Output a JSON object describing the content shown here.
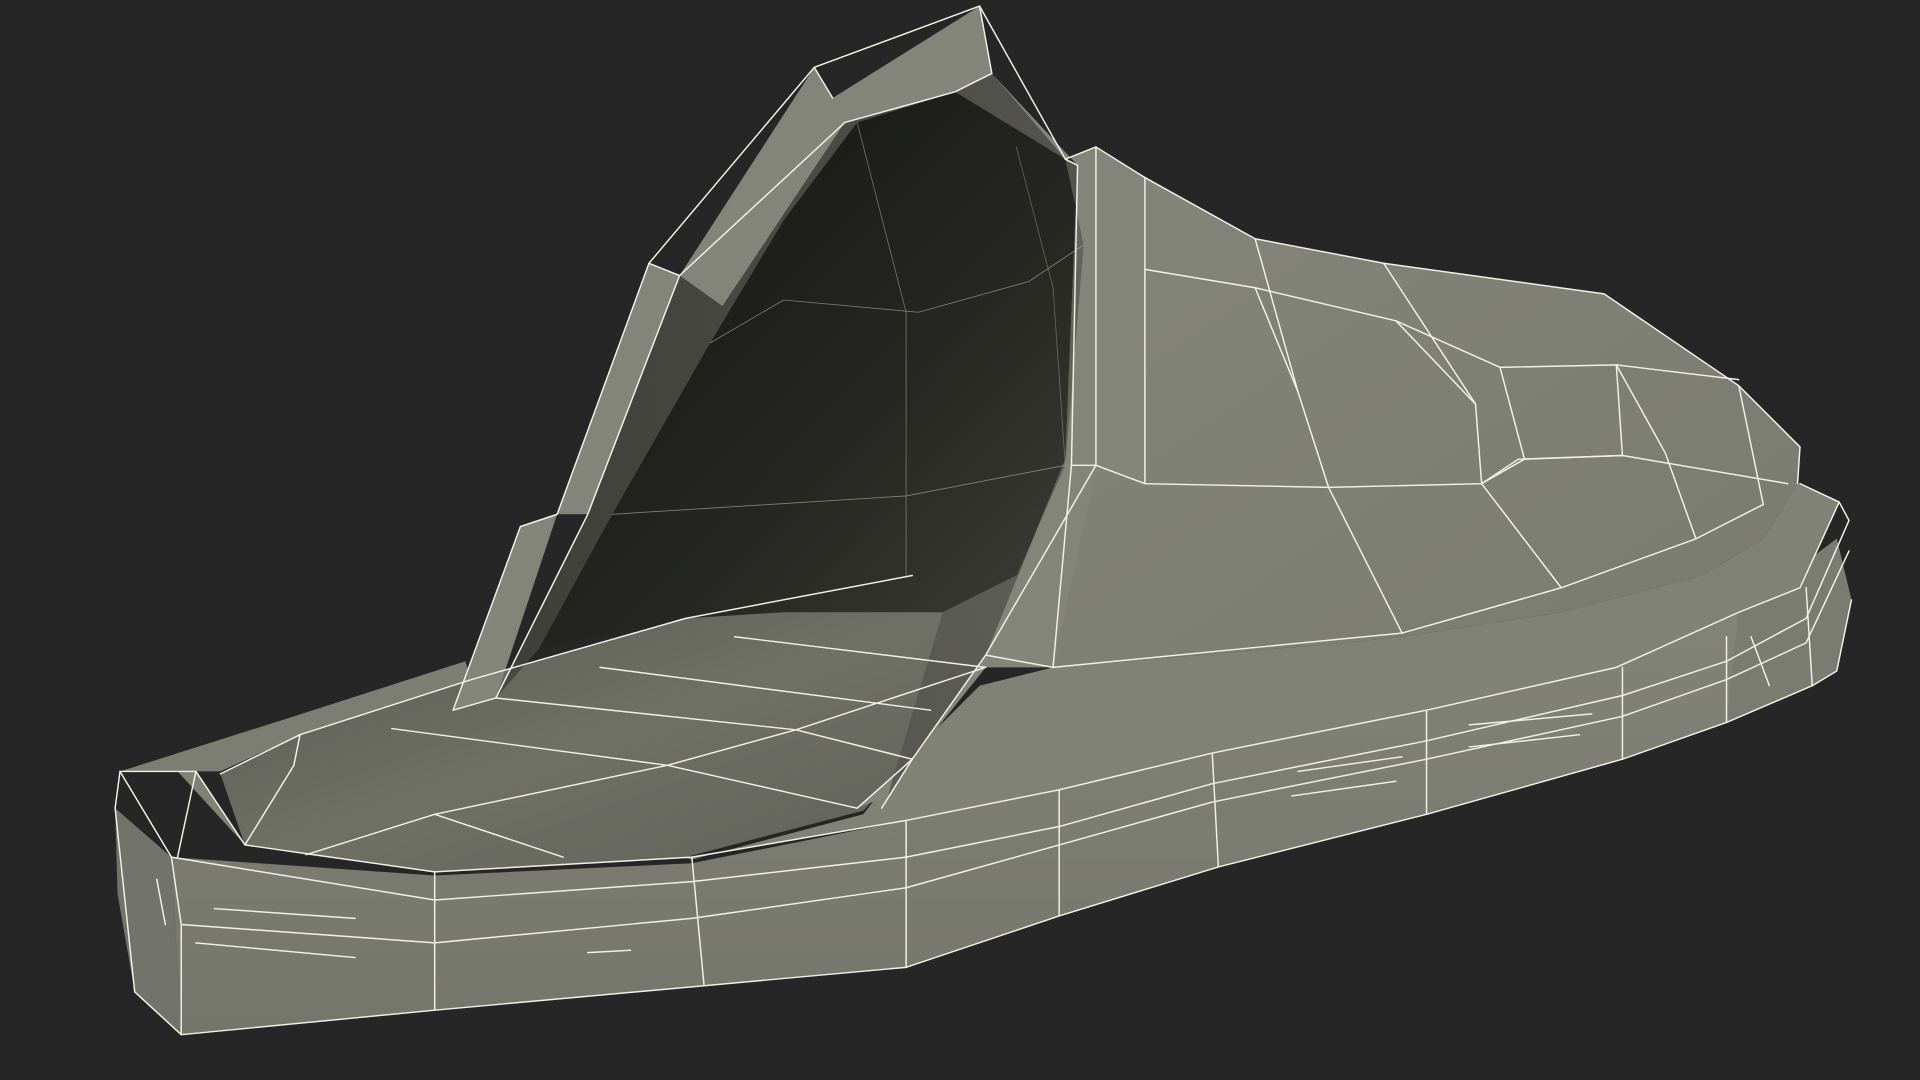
{
  "scene": {
    "subject": "slipper-wireframe-render",
    "colors": {
      "background": "#262626",
      "surface_light": "#7e7f74",
      "surface_mid": "#6f7066",
      "surface_dark": "#5a5b52",
      "interior_dark": "#1f201c",
      "interior_mid": "#35362f",
      "wireframe": "#f2f0e6"
    }
  }
}
